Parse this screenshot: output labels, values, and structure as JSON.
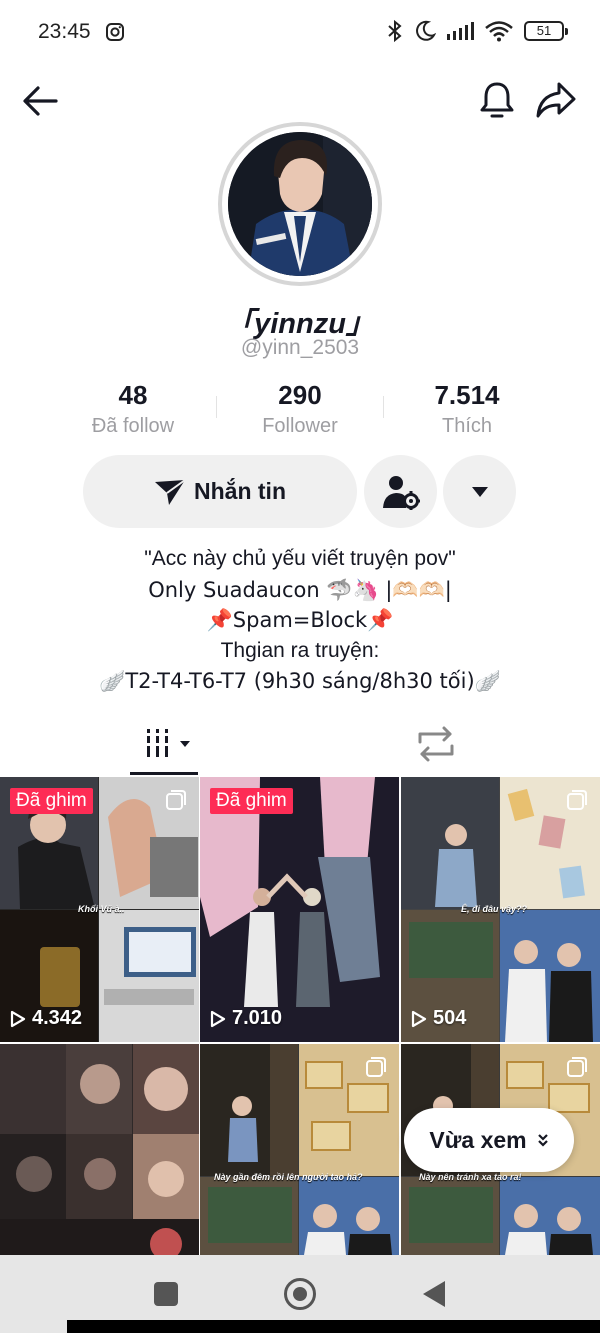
{
  "status_bar": {
    "time": "23:45",
    "battery": "51",
    "icons": [
      "instagram-icon",
      "bluetooth-icon",
      "moon-icon",
      "signal-icon",
      "wifi-icon",
      "battery-icon"
    ]
  },
  "nav": {
    "icons": [
      "back-arrow-icon",
      "bell-icon",
      "share-icon"
    ]
  },
  "profile": {
    "display_name": "「yinnzu」",
    "username": "@yinn_2503",
    "stats": [
      {
        "value": "48",
        "label": "Đã follow"
      },
      {
        "value": "290",
        "label": "Follower"
      },
      {
        "value": "7.514",
        "label": "Thích"
      }
    ]
  },
  "actions": {
    "message_label": "Nhắn tin",
    "icons": [
      "send-icon",
      "person-gear-icon",
      "caret-down-icon"
    ]
  },
  "bio": [
    "\"Acc này chủ yếu viết truyện pov\"",
    "Only Suadaucon 🦈🦄 |🫶🏻🫶🏻|",
    "📌Spam=Block📌",
    "Thgian ra truyện:",
    "🪽T2-T4-T6-T7 (9h30 sáng/8h30 tối)🪽"
  ],
  "tabs": {
    "icons": [
      "videos-grid-icon",
      "repost-icon"
    ]
  },
  "videos": [
    {
      "pinned": "Đã ghim",
      "views": "4.342",
      "caption": "Khối Vũ à.."
    },
    {
      "pinned": "Đã ghim",
      "views": "7.010"
    },
    {
      "views": "504",
      "caption": "Ê, đi đâu vậy??"
    },
    {},
    {
      "caption": "Này gần đêm rồi lên người tao hả?"
    },
    {
      "caption": "Này nên tránh xa tao ra!"
    }
  ],
  "recent_button": {
    "label": "Vừa xem"
  },
  "colors": {
    "pin_badge": "#fe2c55",
    "text": "#161823",
    "muted": "#9e9ea2",
    "button_bg": "#f0f0f0"
  }
}
